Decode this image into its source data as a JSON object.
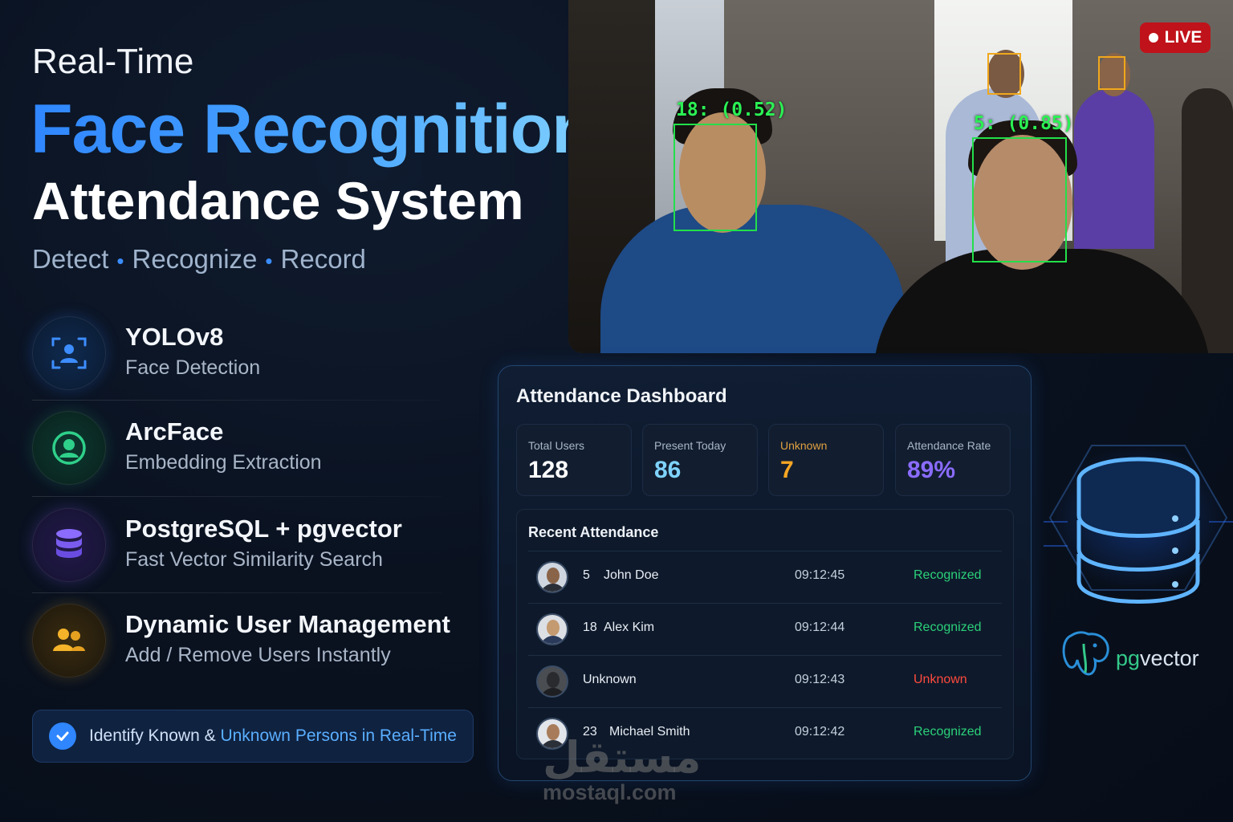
{
  "hero": {
    "line1": "Real-Time",
    "line2": "Face Recognition",
    "line3": "Attendance System",
    "tagline": [
      "Detect",
      "Recognize",
      "Record"
    ]
  },
  "features": [
    {
      "title": "YOLOv8",
      "desc": "Face Detection",
      "icon": "face-scan-icon"
    },
    {
      "title": "ArcFace",
      "desc": "Embedding Extraction",
      "icon": "user-circle-icon"
    },
    {
      "title": "PostgreSQL + pgvector",
      "desc": "Fast Vector Similarity Search",
      "icon": "database-icon"
    },
    {
      "title": "Dynamic User Management",
      "desc": "Add / Remove Users Instantly",
      "icon": "users-icon"
    }
  ],
  "identify": {
    "part1": "Identify Known & ",
    "part2": "Unknown Persons in Real-Time"
  },
  "camera": {
    "live_label": "LIVE",
    "detections": [
      {
        "label": "18: (0.52)",
        "status": "recognized"
      },
      {
        "label": "5: (0.85)",
        "status": "recognized"
      }
    ]
  },
  "dashboard": {
    "title": "Attendance Dashboard",
    "stats": [
      {
        "label": "Total Users",
        "value": "128",
        "color": "#ffffff",
        "label_color": "#a8b6c8"
      },
      {
        "label": "Present Today",
        "value": "86",
        "color": "#7fd3ff",
        "label_color": "#a8b6c8"
      },
      {
        "label": "Unknown",
        "value": "7",
        "color": "#f5a623",
        "label_color": "#e0a040"
      },
      {
        "label": "Attendance Rate",
        "value": "89%",
        "color": "#8a6cff",
        "label_color": "#a8b6c8"
      }
    ],
    "recent_title": "Recent Attendance",
    "rows": [
      {
        "id": "5",
        "name": "John Doe",
        "time": "09:12:45",
        "status": "Recognized",
        "status_color": "#2bd17a"
      },
      {
        "id": "18",
        "name": "Alex Kim",
        "time": "09:12:44",
        "status": "Recognized",
        "status_color": "#2bd17a"
      },
      {
        "id": "",
        "name": "Unknown",
        "time": "09:12:43",
        "status": "Unknown",
        "status_color": "#ff4a3d"
      },
      {
        "id": "23",
        "name": "Michael Smith",
        "time": "09:12:42",
        "status": "Recognized",
        "status_color": "#2bd17a"
      }
    ]
  },
  "pgvector": {
    "prefix": "pg",
    "suffix": "vector"
  },
  "watermark": {
    "arabic": "مستقل",
    "latin": "mostaql.com"
  },
  "colors": {
    "accent": "#2f86ff",
    "recognized": "#2bd17a",
    "unknown": "#ff4a3d",
    "bbox": "#22e04a",
    "bbox_pending": "#f0a81c",
    "live": "#c0121a"
  }
}
